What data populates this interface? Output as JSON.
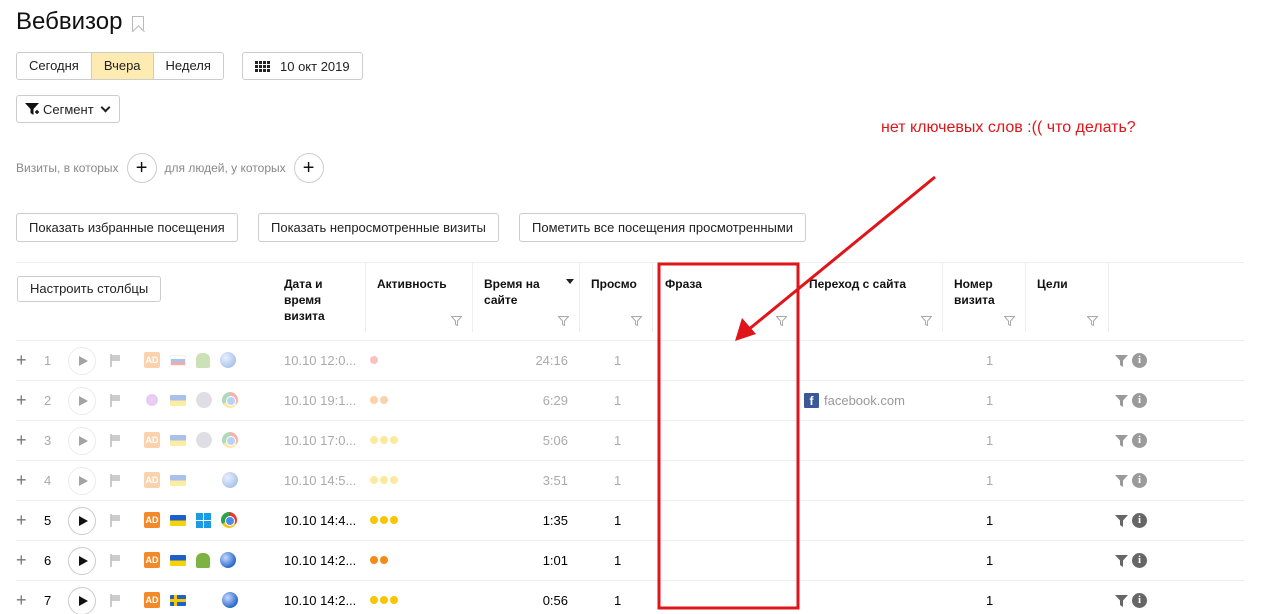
{
  "title": "Вебвизор",
  "periods": [
    {
      "label": "Сегодня",
      "active": false
    },
    {
      "label": "Вчера",
      "active": true
    },
    {
      "label": "Неделя",
      "active": false
    }
  ],
  "date_label": "10 окт 2019",
  "segment_label": "Сегмент",
  "annotation": "нет ключевых слов :((  что делать?",
  "conditions": {
    "visits_label": "Визиты, в которых",
    "people_label": "для людей, у которых",
    "add_symbol": "+"
  },
  "actions": {
    "show_favorites": "Показать избранные посещения",
    "show_unwatched": "Показать непросмотренные визиты",
    "mark_all_watched": "Пометить все посещения просмотренными"
  },
  "columns_button": "Настроить столбцы",
  "columns": {
    "datetime": "Дата и время визита",
    "activity": "Активность",
    "time_on_site": "Время на сайте",
    "views": "Просмо",
    "phrase": "Фраза",
    "referrer": "Переход с сайта",
    "visit_number": "Номер визита",
    "goals": "Цели"
  },
  "colors": {
    "annotation_red": "#e0151a",
    "active_period_bg": "#fdebb1",
    "activity_yellow": "#f7c600",
    "activity_orange": "#f58a16",
    "activity_red": "#f45c5c"
  },
  "rows": [
    {
      "num": "1",
      "date": "10.10 12:0...",
      "activity_dots": 1,
      "activity_color": "red",
      "time": "24:16",
      "views": "1",
      "referrer": "",
      "visit_number": "1",
      "dim": true,
      "icons": [
        "ad-icon",
        "flag-ru-icon",
        "android-icon",
        "globe-icon"
      ]
    },
    {
      "num": "2",
      "date": "10.10 19:1...",
      "activity_dots": 2,
      "activity_color": "orange",
      "time": "6:29",
      "views": "1",
      "referrer": "facebook.com",
      "visit_number": "1",
      "dim": true,
      "icons": [
        "person-icon",
        "flag-ua-icon",
        "apple-icon",
        "chrome-icon"
      ]
    },
    {
      "num": "3",
      "date": "10.10 17:0...",
      "activity_dots": 3,
      "activity_color": "yellow",
      "time": "5:06",
      "views": "1",
      "referrer": "",
      "visit_number": "1",
      "dim": true,
      "icons": [
        "ad-icon",
        "flag-ua-icon",
        "apple-icon",
        "chrome-icon"
      ]
    },
    {
      "num": "4",
      "date": "10.10 14:5...",
      "activity_dots": 3,
      "activity_color": "yellow",
      "time": "3:51",
      "views": "1",
      "referrer": "",
      "visit_number": "1",
      "dim": true,
      "icons": [
        "ad-icon",
        "flag-ua-icon",
        "none",
        "globe-icon"
      ]
    },
    {
      "num": "5",
      "date": "10.10 14:4...",
      "activity_dots": 3,
      "activity_color": "yellow",
      "time": "1:35",
      "views": "1",
      "referrer": "",
      "visit_number": "1",
      "dim": false,
      "icons": [
        "ad-icon",
        "flag-ua-icon",
        "windows-icon",
        "chrome-icon"
      ]
    },
    {
      "num": "6",
      "date": "10.10 14:2...",
      "activity_dots": 2,
      "activity_color": "orange",
      "time": "1:01",
      "views": "1",
      "referrer": "",
      "visit_number": "1",
      "dim": false,
      "icons": [
        "ad-icon",
        "flag-ua-icon",
        "android-icon",
        "globe-icon"
      ]
    },
    {
      "num": "7",
      "date": "10.10 14:2...",
      "activity_dots": 3,
      "activity_color": "yellow",
      "time": "0:56",
      "views": "1",
      "referrer": "",
      "visit_number": "1",
      "dim": false,
      "icons": [
        "ad-icon",
        "flag-se-icon",
        "none",
        "globe-icon"
      ]
    }
  ],
  "icons": {
    "ad_text": "AD",
    "fb_text": "f",
    "info_text": "i",
    "row_plus": "+"
  }
}
